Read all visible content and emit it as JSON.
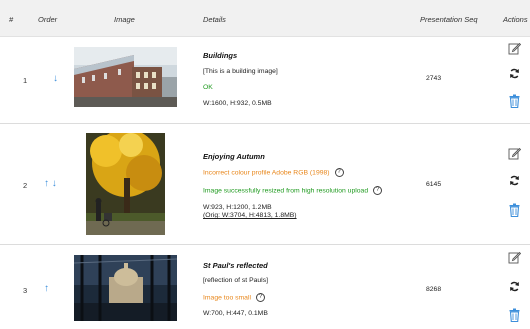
{
  "header": {
    "hash": "#",
    "order": "Order",
    "image": "Image",
    "details": "Details",
    "presentation_seq": "Presentation Seq",
    "actions": "Actions"
  },
  "rows": [
    {
      "num": "1",
      "order_arrows": "↓",
      "title": "Buildings",
      "caption": "[This is a building image]",
      "status": "OK",
      "dims": "W:1600, H:932, 0.5MB",
      "seq": "2743"
    },
    {
      "num": "2",
      "order_arrows": "↑ ↓",
      "title": "Enjoying Autumn",
      "warning": "Incorrect colour profile Adobe RGB (1998)",
      "resized": "Image successfully resized from high resolution upload",
      "dims": "W:923, H:1200, 1.2MB",
      "orig": "(Orig: W:3704, H:4813, 1.8MB)",
      "seq": "6145"
    },
    {
      "num": "3",
      "order_arrows": "↑",
      "title": "St Paul's reflected",
      "caption": "[reflection of st Pauls]",
      "warning": "Image too small",
      "dims": "W:700, H:447, 0.1MB",
      "seq": "8268"
    }
  ],
  "help_glyph": "?",
  "icons": [
    "edit-icon",
    "refresh-icon",
    "trash-icon"
  ],
  "colors": {
    "ok": "#1f9a1f",
    "warning": "#e8861a",
    "arrow": "#3d8fdb",
    "trash": "#3d8fdb"
  }
}
